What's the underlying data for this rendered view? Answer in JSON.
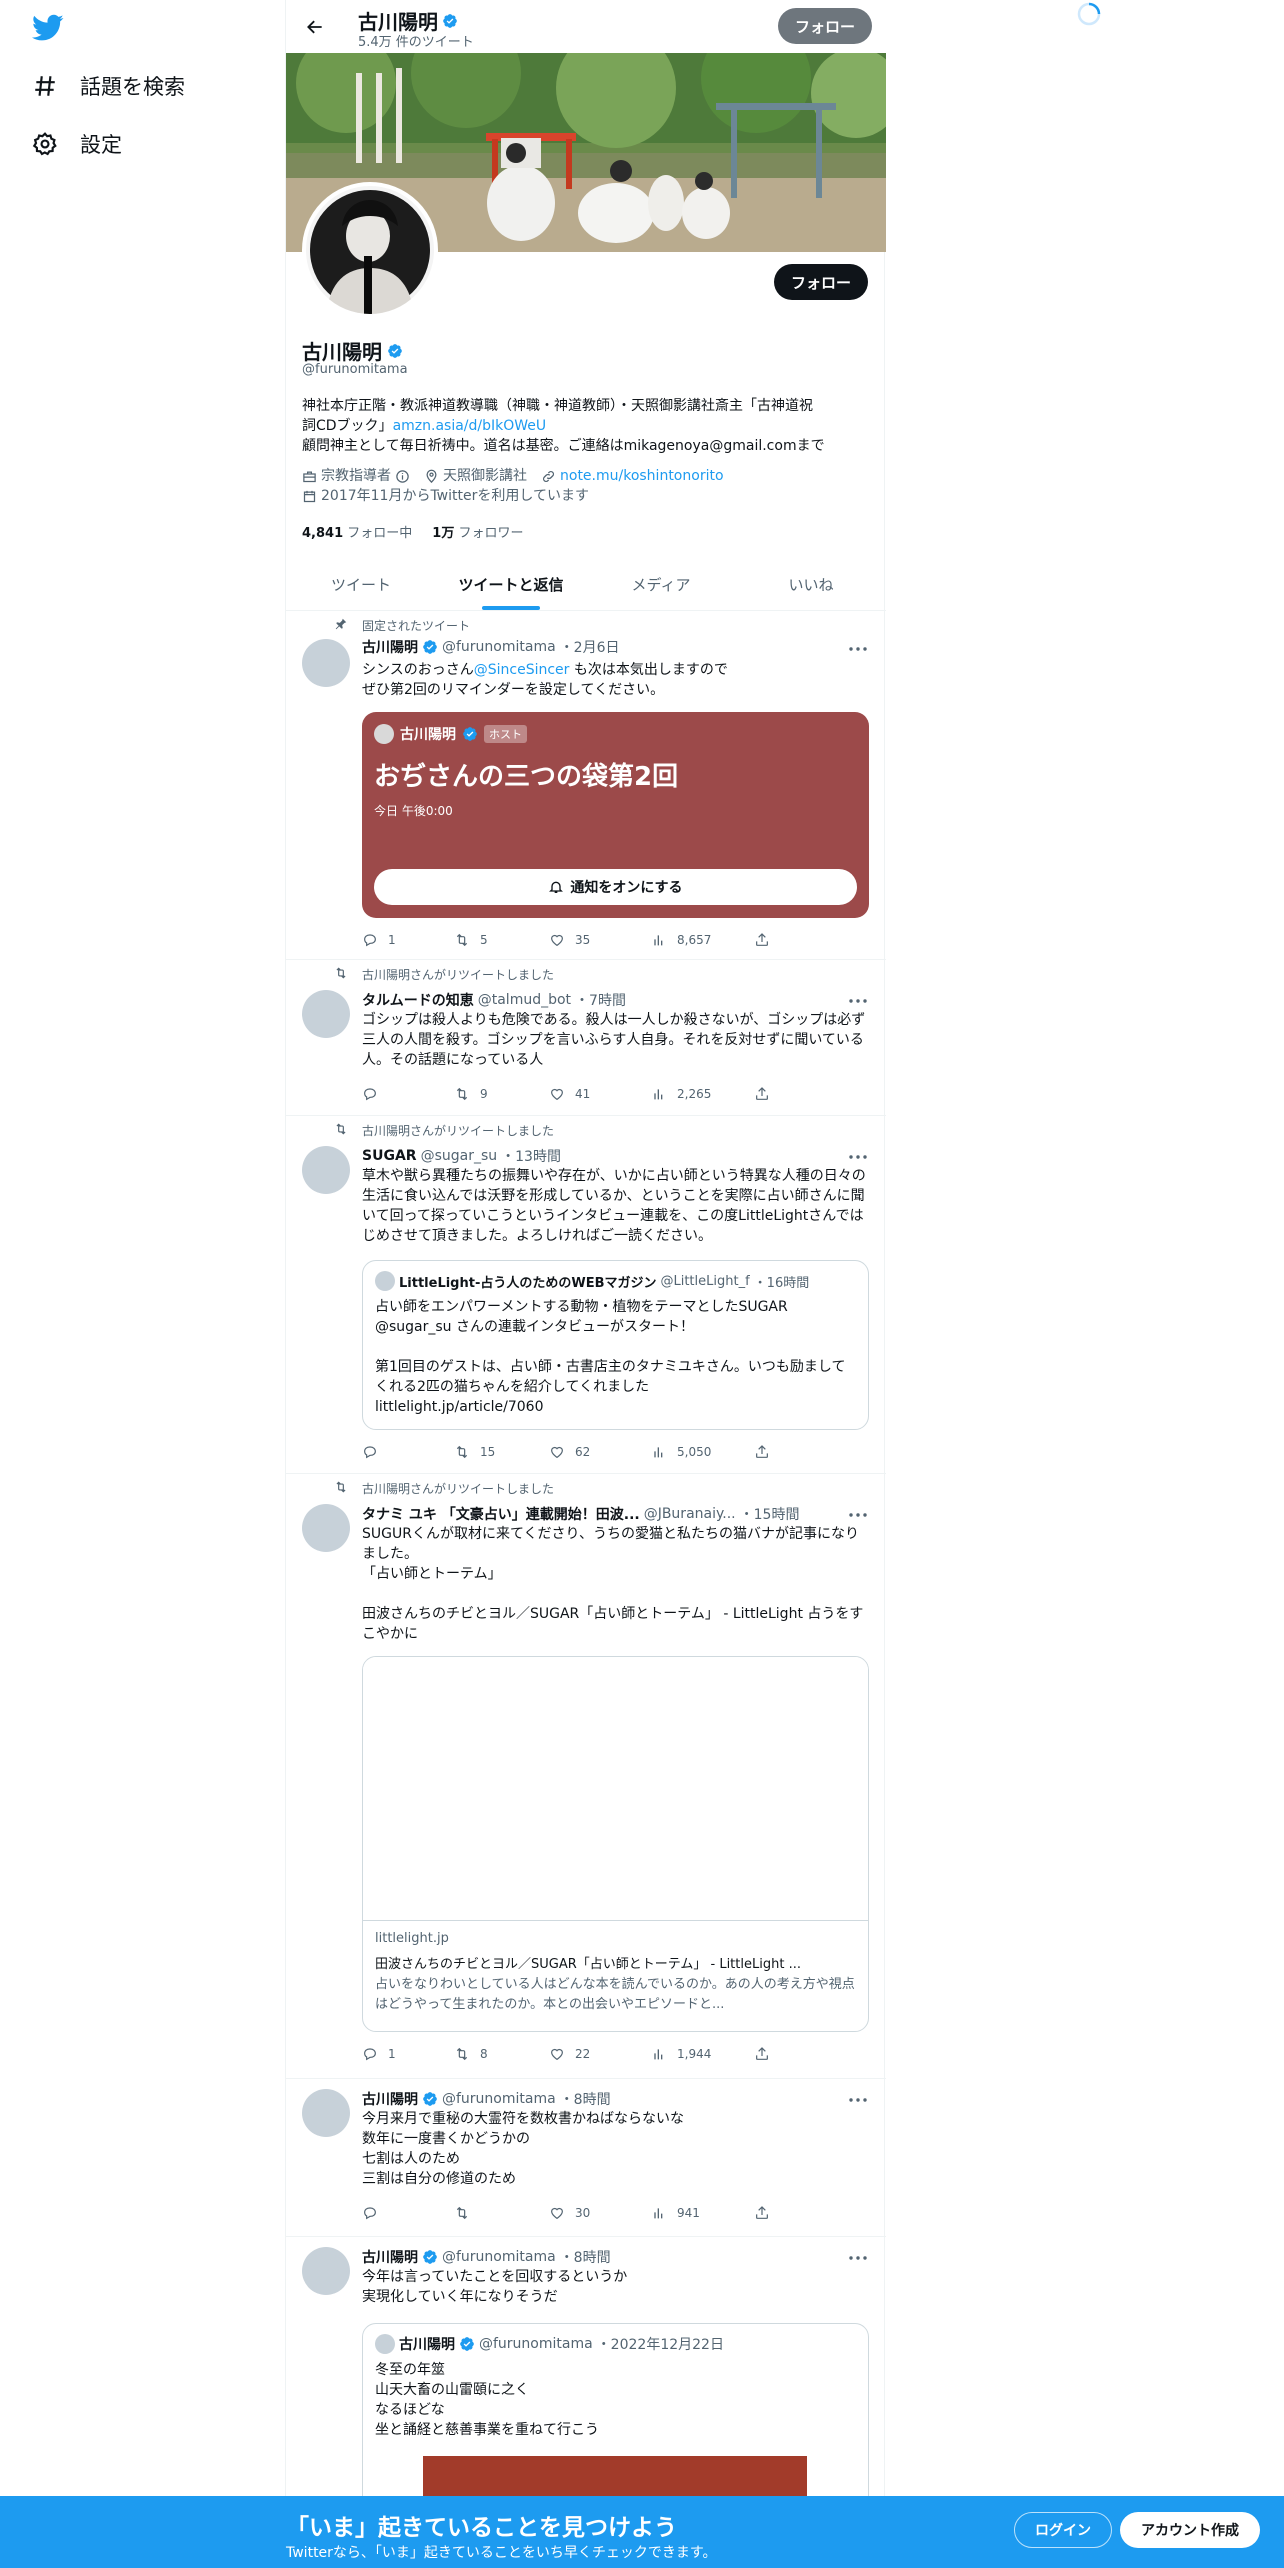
{
  "nav": {
    "explore_label": "話題を検索",
    "settings_label": "設定"
  },
  "header": {
    "name": "古川陽明",
    "tweet_count": "5.4万 件のツイート",
    "follow_label": "フォロー"
  },
  "profile": {
    "name": "古川陽明",
    "handle": "@furunomitama",
    "follow_label": "フォロー",
    "bio_line1": "神社本庁正階・教派神道教導職（神職・神道教師）・天照御影講社斎主「古神道祝",
    "bio_line2_prefix": "詞CDブック」",
    "bio_link": "amzn.asia/d/bIkOWeU",
    "bio_line3": "顧問神主として毎日祈祷中。道名は基密。ご連絡はmikagenoya@gmail.comまで",
    "category": "宗教指導者",
    "location": "天照御影講社",
    "website": "note.mu/koshintonorito",
    "joined": "2017年11月からTwitterを利用しています",
    "following_count": "4,841",
    "following_label": "フォロー中",
    "followers_count": "1万",
    "followers_label": "フォロワー"
  },
  "tabs": [
    "ツイート",
    "ツイートと返信",
    "メディア",
    "いいね"
  ],
  "tweets": [
    {
      "context": "固定されたツイート",
      "name": "古川陽明",
      "handle": "@furunomitama",
      "time": "・2月6日",
      "text_a": "シンスのおっさん",
      "mention": "@SinceSincer",
      "text_b": " も次は本気出しますので\nぜひ第2回のリマインダーを設定してください。",
      "space": {
        "host_name": "古川陽明",
        "host_badge": "ホスト",
        "title": "おぢさんの三つの袋第2回",
        "time": "今日 午後0:00",
        "button": "通知をオンにする",
        "color": "#9c4a4a"
      },
      "replies": "1",
      "retweets": "5",
      "likes": "35",
      "views": "8,657"
    },
    {
      "context": "古川陽明さんがリツイートしました",
      "name": "タルムードの知恵",
      "handle": "@talmud_bot",
      "time": "・7時間",
      "text": "ゴシップは殺人よりも危険である。殺人は一人しか殺さないが、ゴシップは必ず三人の人間を殺す。ゴシップを言いふらす人自身。それを反対せずに聞いている人。その話題になっている人",
      "replies": "",
      "retweets": "9",
      "likes": "41",
      "views": "2,265"
    },
    {
      "context": "古川陽明さんがリツイートしました",
      "name": "SUGAR",
      "handle": "@sugar_su",
      "time": "・13時間",
      "text": "草木や獣ら異種たちの振舞いや存在が、いかに占い師という特異な人種の日々の生活に食い込んでは沃野を形成しているか、ということを実際に占い師さんに聞いて回って探っていこうというインタビュー連載を、この度LittleLightさんではじめさせて頂きました。よろしければご一読ください。",
      "quote": {
        "name": "LittleLight-占う人のためのWEBマガジン",
        "handle": "@LittleLight_f",
        "time": "・16時間",
        "text": "占い師をエンパワーメントする動物・植物をテーマとしたSUGAR\n@sugar_su さんの連載インタビューがスタート！\n\n第1回目のゲストは、占い師・古書店主のタナミユキさん。いつも励ましてくれる2匹の猫ちゃんを紹介してくれました\nlittlelight.jp/article/7060"
      },
      "replies": "",
      "retweets": "15",
      "likes": "62",
      "views": "5,050"
    },
    {
      "context": "古川陽明さんがリツイートしました",
      "name": "タナミ ユキ 「文豪占い」連載開始！田波...",
      "handle": "@JBuranaiy...",
      "time": "・15時間",
      "text": "SUGURくんが取材に来てくださり、うちの愛猫と私たちの猫バナが記事になりました。\n「占い師とトーテム」\n\n田波さんちのチビとヨル／SUGAR「占い師とトーテム」 - LittleLight 占うをすこやかに",
      "link_card": {
        "domain": "littlelight.jp",
        "title": "田波さんちのチビとヨル／SUGAR「占い師とトーテム」 - LittleLight ...",
        "desc": "占いをなりわいとしている人はどんな本を読んでいるのか。あの人の考え方や視点はどうやって生まれたのか。本との出会いやエピソードと..."
      },
      "replies": "1",
      "retweets": "8",
      "likes": "22",
      "views": "1,944"
    },
    {
      "name": "古川陽明",
      "handle": "@furunomitama",
      "time": "・8時間",
      "text": "今月来月で重秘の大霊符を数枚書かねばならないな\n数年に一度書くかどうかの\n七割は人のため\n三割は自分の修道のため",
      "replies": "",
      "retweets": "",
      "likes": "30",
      "views": "941"
    },
    {
      "name": "古川陽明",
      "handle": "@furunomitama",
      "time": "・8時間",
      "text": "今年は言っていたことを回収するというか\n実現化していく年になりそうだ",
      "quote": {
        "name": "古川陽明",
        "handle": "@furunomitama",
        "time": "・2022年12月22日",
        "text": "冬至の年筮\n山天大畜の山雷頤に之く\nなるほどな\n坐と誦経と慈善事業を重ねて行こう"
      }
    }
  ],
  "bottom_bar": {
    "title": "「いま」起きていることを見つけよう",
    "subtitle": "Twitterなら、「いま」起きていることをいち早くチェックできます。",
    "login": "ログイン",
    "signup": "アカウント作成"
  },
  "colors": {
    "accent": "#1d9bf0",
    "text": "#0f1419",
    "secondary": "#536471"
  }
}
